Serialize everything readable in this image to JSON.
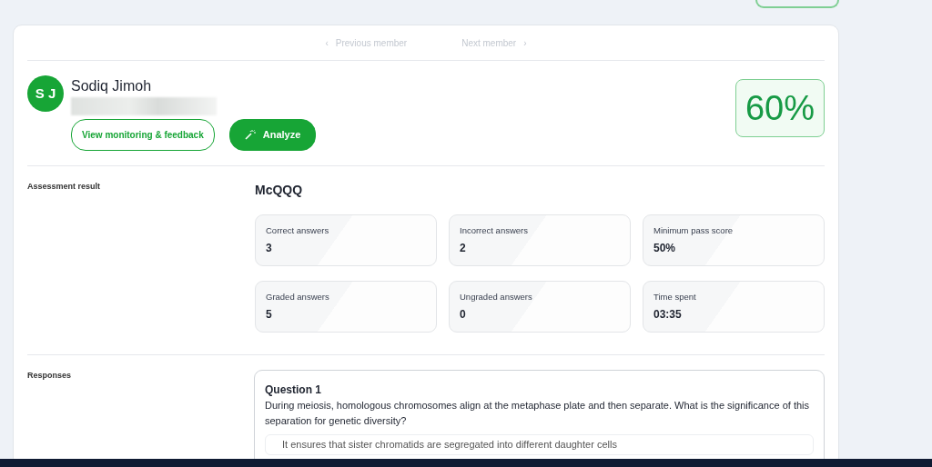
{
  "nav": {
    "previous": {
      "label": "Previous member",
      "icon": "‹",
      "disabled": true
    },
    "next": {
      "label": "Next member",
      "icon": "›",
      "disabled": true
    }
  },
  "member": {
    "initials": "S J",
    "name": "Sodiq Jimoh",
    "score": "60%"
  },
  "buttons": [
    {
      "label": "View monitoring & feedback",
      "kind": "outline"
    },
    {
      "label": "Analyze",
      "kind": "solid"
    }
  ],
  "assessment": {
    "section_label": "Assessment result",
    "title": "McQQQ",
    "stats": [
      {
        "label": "Correct answers",
        "value": "3"
      },
      {
        "label": "Incorrect answers",
        "value": "2"
      },
      {
        "label": "Minimum pass score",
        "value": "50%"
      },
      {
        "label": "Graded answers",
        "value": "5"
      },
      {
        "label": "Ungraded answers",
        "value": "0"
      },
      {
        "label": "Time spent",
        "value": "03:35"
      }
    ]
  },
  "responses": {
    "section_label": "Responses",
    "questions": [
      {
        "title": "Question 1",
        "text": "During meiosis, homologous chromosomes align at the metaphase plate and then separate. What is the significance of this separation for genetic diversity?",
        "options": [
          "It ensures that sister chromatids are segregated into different daughter cells"
        ]
      }
    ]
  }
}
